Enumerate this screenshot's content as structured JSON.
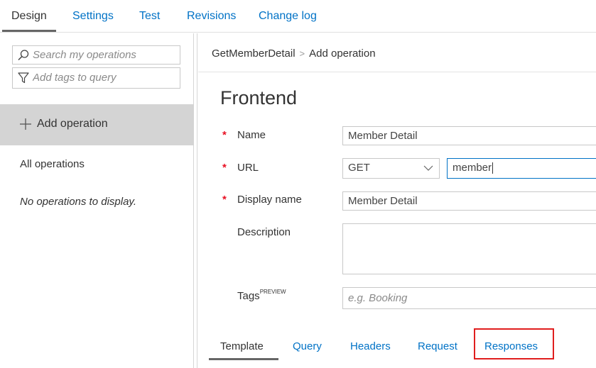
{
  "top_tabs": [
    {
      "label": "Design"
    },
    {
      "label": "Settings"
    },
    {
      "label": "Test"
    },
    {
      "label": "Revisions"
    },
    {
      "label": "Change log"
    }
  ],
  "sidebar": {
    "search_placeholder": "Search my operations",
    "tags_placeholder": "Add tags to query",
    "add_operation": "Add operation",
    "all_operations": "All operations",
    "empty_message": "No operations to display."
  },
  "breadcrumb": {
    "parent": "GetMemberDetail",
    "separator": ">",
    "current": "Add operation"
  },
  "form": {
    "heading": "Frontend",
    "required_mark": "*",
    "name_label": "Name",
    "name_value": "Member Detail",
    "url_label": "URL",
    "method_value": "GET",
    "url_value": "member",
    "display_name_label": "Display name",
    "display_name_value": "Member Detail",
    "description_label": "Description",
    "description_value": "",
    "tags_label": "Tags",
    "tags_badge": "PREVIEW",
    "tags_placeholder": "e.g. Booking"
  },
  "bottom_tabs": [
    {
      "label": "Template"
    },
    {
      "label": "Query"
    },
    {
      "label": "Headers"
    },
    {
      "label": "Request"
    },
    {
      "label": "Responses"
    }
  ],
  "colors": {
    "link": "#0072c6",
    "required": "#e81123",
    "highlight": "#e01e1e",
    "selected_bg": "#d4d4d4"
  },
  "icons": [
    "search-icon",
    "filter-icon",
    "plus-icon",
    "chevron-down-icon"
  ]
}
